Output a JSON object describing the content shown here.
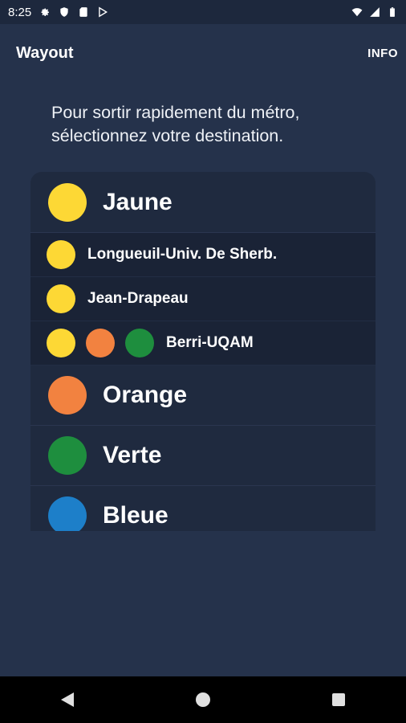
{
  "status_bar": {
    "time": "8:25"
  },
  "app_bar": {
    "title": "Wayout",
    "info_label": "INFO"
  },
  "prompt": {
    "line1": "Pour sortir rapidement du métro,",
    "line2": "sélectionnez votre destination."
  },
  "colors": {
    "jaune": "#fdd835",
    "orange": "#f28240",
    "verte": "#1e8e3e",
    "bleue": "#1d7fc9",
    "background": "#25324b"
  },
  "lines": [
    {
      "label": "Jaune",
      "color": "#fdd835",
      "expanded": true,
      "stations": [
        {
          "label": "Longueuil-Univ. De Sherb.",
          "line_colors": [
            "#fdd835"
          ]
        },
        {
          "label": "Jean-Drapeau",
          "line_colors": [
            "#fdd835"
          ]
        },
        {
          "label": "Berri-UQAM",
          "line_colors": [
            "#fdd835",
            "#f28240",
            "#1e8e3e"
          ]
        }
      ]
    },
    {
      "label": "Orange",
      "color": "#f28240",
      "expanded": false
    },
    {
      "label": "Verte",
      "color": "#1e8e3e",
      "expanded": false
    },
    {
      "label": "Bleue",
      "color": "#1d7fc9",
      "expanded": false
    }
  ],
  "nav": {
    "back_icon": "back-triangle-icon",
    "home_icon": "home-circle-icon",
    "recents_icon": "recents-square-icon"
  }
}
